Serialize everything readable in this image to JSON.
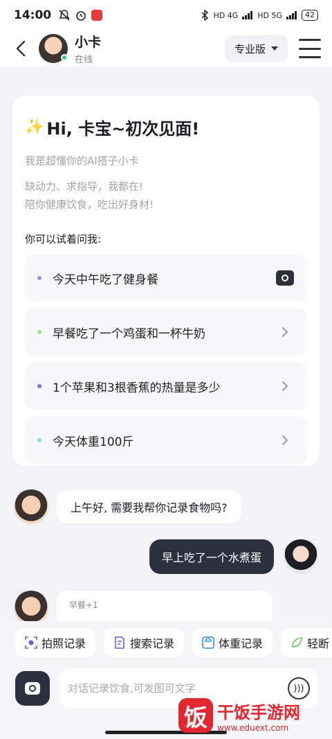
{
  "status_bar": {
    "time": "14:00",
    "network_1": "HD 4G",
    "network_2": "HD 5G",
    "battery": "42"
  },
  "header": {
    "back_icon": "chevron-left-icon",
    "bot_name": "小卡",
    "bot_status": "在线",
    "plan": "专业版",
    "menu_icon": "hamburger-menu-icon"
  },
  "welcome": {
    "title": "Hi, 卡宝~初次见面!",
    "intro": "我是超懂你的AI搭子小卡",
    "lines": [
      "缺动力、求指导，我都在!",
      "陪你健康饮食，吃出好身材!"
    ],
    "ask_label": "你可以试着问我:",
    "suggestions": [
      {
        "text": "今天中午吃了健身餐",
        "dot_color": "#9b8ee8",
        "end_icon": "camera-icon"
      },
      {
        "text": "早餐吃了一个鸡蛋和一杯牛奶",
        "dot_color": "#a9e07f",
        "end_icon": "chevron-right-icon"
      },
      {
        "text": "1个苹果和3根香蕉的热量是多少",
        "dot_color": "#7c74d6",
        "end_icon": "chevron-right-icon"
      },
      {
        "text": "今天体重100斤",
        "dot_color": "#8fd3f0",
        "end_icon": "chevron-right-icon"
      }
    ]
  },
  "chat": {
    "bot_greeting": "上午好, 需要我帮你记录食物吗?",
    "user_message": "早上吃了一个水煮蛋",
    "record_label": "早餐+1"
  },
  "quick_actions": [
    {
      "label": "拍照记录",
      "icon": "camera-scan-icon"
    },
    {
      "label": "搜索记录",
      "icon": "search-document-icon"
    },
    {
      "label": "体重记录",
      "icon": "scale-icon"
    },
    {
      "label": "轻断",
      "icon": "leaf-icon"
    }
  ],
  "input": {
    "placeholder": "对话记录饮食,可发图可文字"
  },
  "watermark": {
    "logo_char": "饭",
    "title": "干饭手游网",
    "url": "www.eduext.com"
  }
}
